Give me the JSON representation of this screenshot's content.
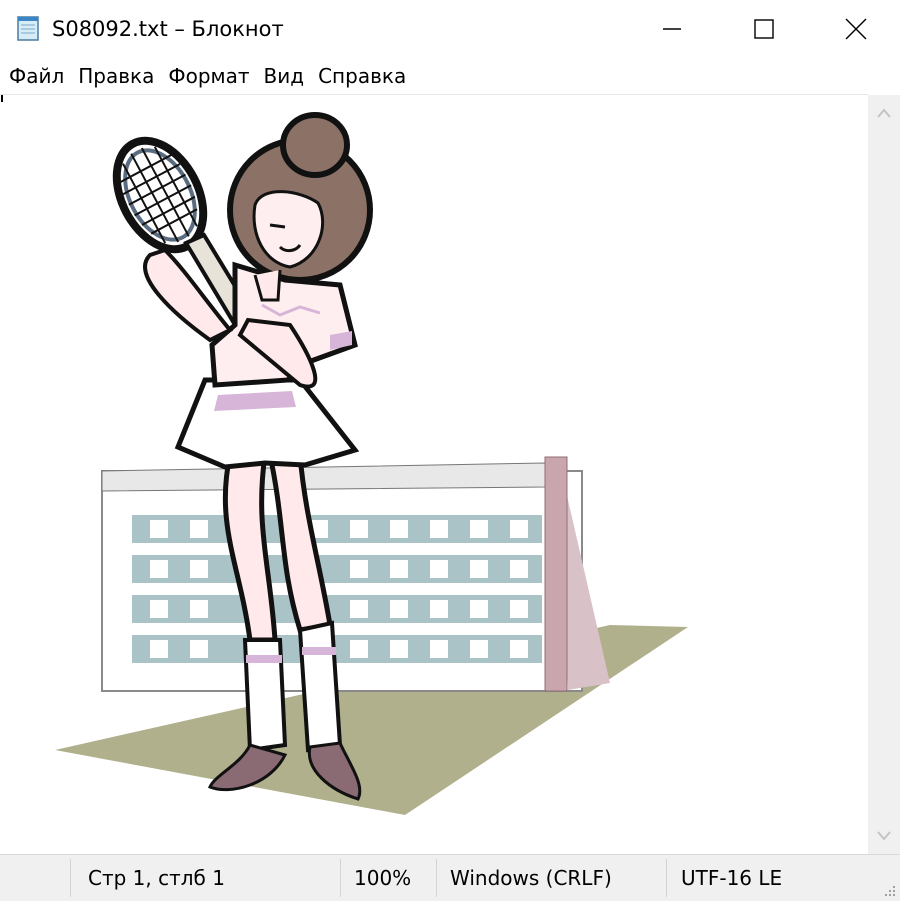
{
  "window": {
    "title": "S08092.txt – Блокнот",
    "app_icon": "notepad-icon",
    "controls": {
      "minimize": "minimize-icon",
      "maximize": "maximize-icon",
      "close": "close-icon"
    }
  },
  "menu": [
    {
      "label": "Файл"
    },
    {
      "label": "Правка"
    },
    {
      "label": "Формат"
    },
    {
      "label": "Вид"
    },
    {
      "label": "Справка"
    }
  ],
  "editor": {
    "content": "clip-art of a woman holding a tennis racket in front of a tennis net"
  },
  "status": {
    "position": "Стр 1, стлб 1",
    "zoom": "100%",
    "line_endings": "Windows (CRLF)",
    "encoding": "UTF-16 LE"
  },
  "colors": {
    "hair": "#8b7166",
    "skirt_accent": "#d7b5d8",
    "net_blue": "#a9c3c6",
    "court": "#b0b08c",
    "post": "#c9a6ad",
    "shoes": "#8a6a73"
  }
}
